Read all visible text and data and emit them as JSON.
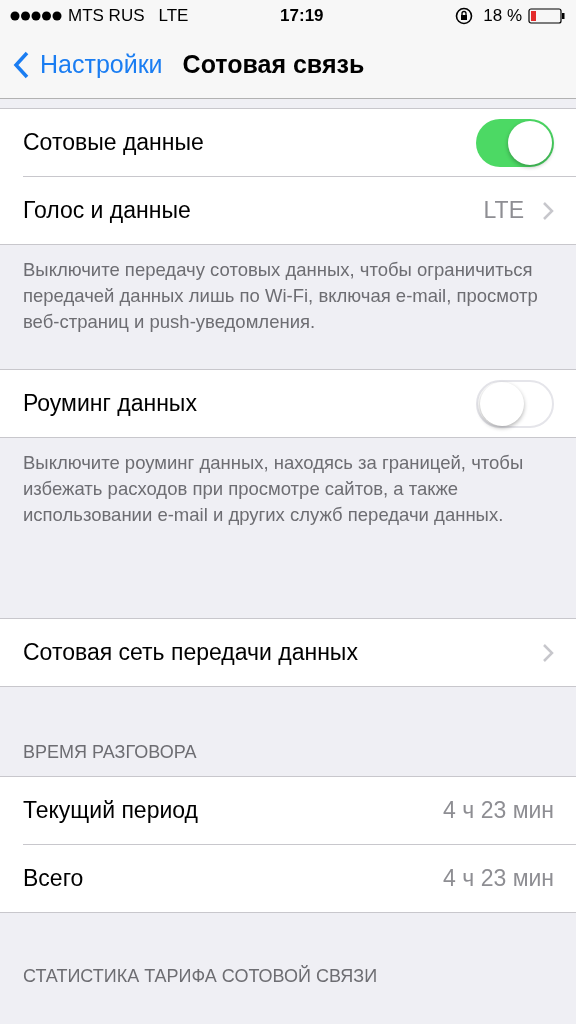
{
  "status_bar": {
    "carrier": "MTS RUS",
    "network": "LTE",
    "time": "17:19",
    "battery": "18 %"
  },
  "nav": {
    "back": "Настройки",
    "title": "Сотовая связь"
  },
  "sections": [
    {
      "rows": [
        {
          "kind": "toggle",
          "label": "Сотовые данные",
          "on": true
        },
        {
          "kind": "link",
          "label": "Голос и данные",
          "value": "LTE"
        }
      ],
      "footer": "Выключите передачу сотовых данных, чтобы ограничиться передачей данных лишь по Wi-Fi, включая e-mail, просмотр веб-страниц и push-уведомления."
    },
    {
      "rows": [
        {
          "kind": "toggle",
          "label": "Роуминг данных",
          "on": false
        }
      ],
      "footer": "Выключите роуминг данных, находясь за границей, чтобы избежать расходов при просмотре сайтов, а также использовании e-mail и других служб передачи данных."
    },
    {
      "rows": [
        {
          "kind": "link",
          "label": "Сотовая сеть передачи данных"
        }
      ]
    },
    {
      "header": "ВРЕМЯ РАЗГОВОРА",
      "rows": [
        {
          "kind": "value",
          "label": "Текущий период",
          "value": "4 ч 23 мин"
        },
        {
          "kind": "value",
          "label": "Всего",
          "value": "4 ч 23 мин"
        }
      ]
    },
    {
      "header": "СТАТИСТИКА ТАРИФА СОТОВОЙ СВЯЗИ"
    }
  ]
}
